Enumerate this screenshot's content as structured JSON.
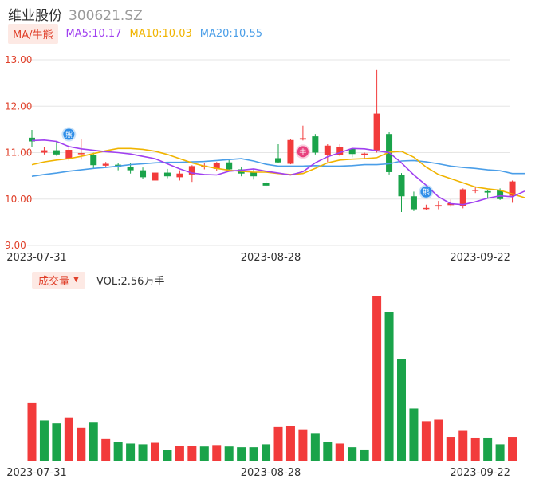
{
  "header": {
    "name": "维业股份",
    "code": "300621.SZ"
  },
  "ma_legend": {
    "toggle_label": "MA/牛熊",
    "items": [
      {
        "label": "MA5:10.17",
        "color": "#a040f0"
      },
      {
        "label": "MA10:10.03",
        "color": "#f0b400"
      },
      {
        "label": "MA20:10.55",
        "color": "#4a9ee8"
      }
    ]
  },
  "volume_legend": {
    "toggle_label": "成交量",
    "value_label": "VOL:2.56万手"
  },
  "colors": {
    "up": "#f23b3b",
    "down": "#1aa34a",
    "grid": "#e6e6e6",
    "axis_text": "#e0402a",
    "date_text": "#333333"
  },
  "chart_data": [
    {
      "type": "candlestick",
      "yticks": [
        "13.00",
        "12.00",
        "11.00",
        "10.00",
        "9.00"
      ],
      "ylim": [
        9,
        13
      ],
      "xtick_labels": [
        "2023-07-31",
        "2023-08-28",
        "2023-09-22"
      ],
      "xtick_index": [
        0,
        19,
        36
      ],
      "markers": [
        {
          "index": 3,
          "label": "熊",
          "color": "#2f8ee8"
        },
        {
          "index": 22,
          "label": "牛",
          "color": "#e8417e"
        },
        {
          "index": 32,
          "label": "熊",
          "color": "#2f8ee8"
        }
      ],
      "candles": [
        {
          "o": 11.32,
          "h": 11.49,
          "l": 11.12,
          "c": 11.24
        },
        {
          "o": 11.0,
          "h": 11.12,
          "l": 10.96,
          "c": 11.05
        },
        {
          "o": 11.05,
          "h": 11.25,
          "l": 10.93,
          "c": 10.96
        },
        {
          "o": 10.87,
          "h": 11.12,
          "l": 10.83,
          "c": 11.06
        },
        {
          "o": 10.98,
          "h": 11.3,
          "l": 10.85,
          "c": 10.99
        },
        {
          "o": 10.95,
          "h": 11.0,
          "l": 10.65,
          "c": 10.73
        },
        {
          "o": 10.72,
          "h": 10.8,
          "l": 10.68,
          "c": 10.76
        },
        {
          "o": 10.74,
          "h": 10.78,
          "l": 10.62,
          "c": 10.69
        },
        {
          "o": 10.7,
          "h": 10.78,
          "l": 10.55,
          "c": 10.62
        },
        {
          "o": 10.62,
          "h": 10.68,
          "l": 10.44,
          "c": 10.47
        },
        {
          "o": 10.4,
          "h": 10.58,
          "l": 10.2,
          "c": 10.57
        },
        {
          "o": 10.57,
          "h": 10.65,
          "l": 10.45,
          "c": 10.49
        },
        {
          "o": 10.47,
          "h": 10.62,
          "l": 10.4,
          "c": 10.55
        },
        {
          "o": 10.53,
          "h": 10.73,
          "l": 10.37,
          "c": 10.71
        },
        {
          "o": 10.71,
          "h": 10.78,
          "l": 10.64,
          "c": 10.72
        },
        {
          "o": 10.65,
          "h": 10.8,
          "l": 10.6,
          "c": 10.77
        },
        {
          "o": 10.79,
          "h": 10.84,
          "l": 10.61,
          "c": 10.64
        },
        {
          "o": 10.64,
          "h": 10.7,
          "l": 10.49,
          "c": 10.55
        },
        {
          "o": 10.58,
          "h": 10.64,
          "l": 10.42,
          "c": 10.49
        },
        {
          "o": 10.34,
          "h": 10.4,
          "l": 10.28,
          "c": 10.29
        },
        {
          "o": 10.88,
          "h": 11.18,
          "l": 10.78,
          "c": 10.79
        },
        {
          "o": 10.76,
          "h": 11.3,
          "l": 10.75,
          "c": 11.27
        },
        {
          "o": 11.28,
          "h": 11.58,
          "l": 11.26,
          "c": 11.31
        },
        {
          "o": 11.35,
          "h": 11.4,
          "l": 10.96,
          "c": 11.0
        },
        {
          "o": 10.95,
          "h": 11.18,
          "l": 10.8,
          "c": 11.15
        },
        {
          "o": 10.95,
          "h": 11.18,
          "l": 10.92,
          "c": 11.12
        },
        {
          "o": 11.08,
          "h": 11.1,
          "l": 10.9,
          "c": 10.97
        },
        {
          "o": 10.96,
          "h": 11.0,
          "l": 10.88,
          "c": 10.98
        },
        {
          "o": 11.05,
          "h": 12.78,
          "l": 11.0,
          "c": 11.84
        },
        {
          "o": 11.4,
          "h": 11.45,
          "l": 10.53,
          "c": 10.58
        },
        {
          "o": 10.52,
          "h": 10.56,
          "l": 9.72,
          "c": 10.06
        },
        {
          "o": 10.06,
          "h": 10.16,
          "l": 9.74,
          "c": 9.78
        },
        {
          "o": 9.8,
          "h": 9.88,
          "l": 9.76,
          "c": 9.81
        },
        {
          "o": 9.84,
          "h": 9.96,
          "l": 9.78,
          "c": 9.87
        },
        {
          "o": 9.87,
          "h": 9.99,
          "l": 9.83,
          "c": 9.91
        },
        {
          "o": 9.85,
          "h": 10.23,
          "l": 9.8,
          "c": 10.21
        },
        {
          "o": 10.18,
          "h": 10.25,
          "l": 10.13,
          "c": 10.2
        },
        {
          "o": 10.17,
          "h": 10.2,
          "l": 10.03,
          "c": 10.14
        },
        {
          "o": 10.2,
          "h": 10.23,
          "l": 9.98,
          "c": 10.0
        },
        {
          "o": 10.07,
          "h": 10.4,
          "l": 9.92,
          "c": 10.38
        }
      ],
      "ma5": [
        11.26,
        11.27,
        11.24,
        11.13,
        11.08,
        11.05,
        11.02,
        11.0,
        10.97,
        10.92,
        10.87,
        10.76,
        10.65,
        10.56,
        10.53,
        10.52,
        10.6,
        10.62,
        10.65,
        10.6,
        10.56,
        10.52,
        10.59,
        10.78,
        10.91,
        11.0,
        11.09,
        11.08,
        11.04,
        11.0,
        10.78,
        10.52,
        10.3,
        10.05,
        9.9,
        9.88,
        9.94,
        10.02,
        10.07,
        10.05,
        10.17
      ],
      "ma10": [
        10.74,
        10.8,
        10.84,
        10.87,
        10.92,
        10.98,
        11.04,
        11.09,
        11.09,
        11.07,
        11.03,
        10.96,
        10.87,
        10.78,
        10.71,
        10.66,
        10.62,
        10.6,
        10.58,
        10.58,
        10.55,
        10.53,
        10.55,
        10.66,
        10.78,
        10.84,
        10.86,
        10.87,
        10.89,
        11.01,
        11.03,
        10.9,
        10.69,
        10.53,
        10.44,
        10.35,
        10.26,
        10.22,
        10.19,
        10.11,
        10.03
      ],
      "ma20": [
        10.49,
        10.53,
        10.56,
        10.6,
        10.63,
        10.66,
        10.68,
        10.71,
        10.74,
        10.76,
        10.78,
        10.79,
        10.79,
        10.8,
        10.81,
        10.83,
        10.85,
        10.87,
        10.82,
        10.75,
        10.71,
        10.71,
        10.71,
        10.72,
        10.71,
        10.71,
        10.72,
        10.74,
        10.74,
        10.76,
        10.82,
        10.83,
        10.8,
        10.76,
        10.71,
        10.68,
        10.66,
        10.63,
        10.61,
        10.55,
        10.55
      ]
    },
    {
      "type": "bar",
      "title": "成交量",
      "ylim": [
        0,
        2.2
      ],
      "values": [
        0.77,
        0.54,
        0.5,
        0.58,
        0.44,
        0.51,
        0.29,
        0.25,
        0.23,
        0.22,
        0.24,
        0.14,
        0.2,
        0.2,
        0.19,
        0.21,
        0.19,
        0.18,
        0.18,
        0.22,
        0.45,
        0.46,
        0.42,
        0.37,
        0.25,
        0.23,
        0.18,
        0.15,
        2.2,
        1.99,
        1.36,
        0.7,
        0.53,
        0.55,
        0.32,
        0.4,
        0.31,
        0.31,
        0.22,
        0.32
      ],
      "directions": [
        "up",
        "down",
        "down",
        "up",
        "up",
        "down",
        "up",
        "down",
        "down",
        "down",
        "up",
        "down",
        "up",
        "up",
        "down",
        "up",
        "down",
        "down",
        "down",
        "down",
        "up",
        "up",
        "up",
        "down",
        "down",
        "up",
        "down",
        "down",
        "up",
        "down",
        "down",
        "down",
        "up",
        "up",
        "up",
        "up",
        "up",
        "down",
        "down",
        "up"
      ]
    }
  ]
}
